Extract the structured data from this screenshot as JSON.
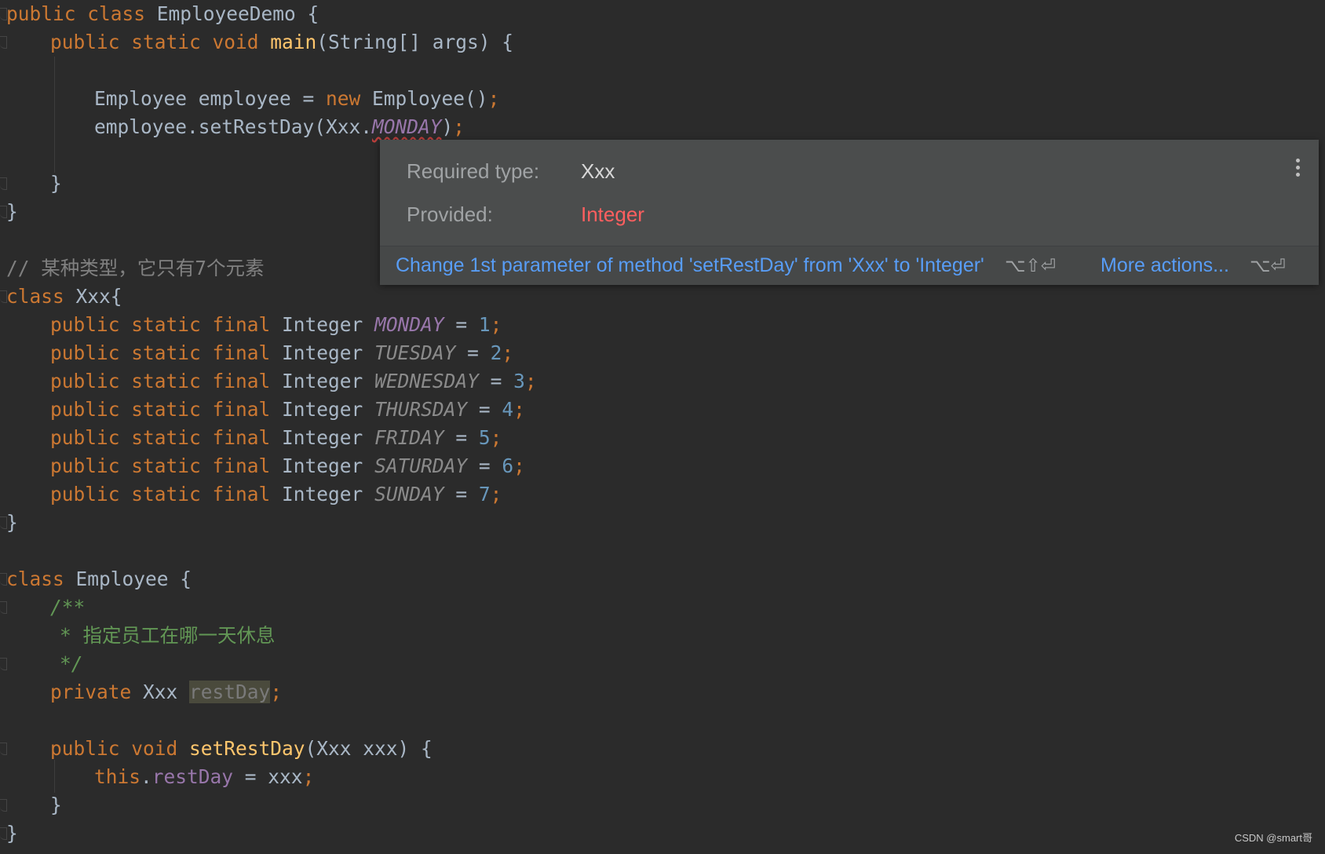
{
  "code": {
    "l1": [
      "public class",
      "EmployeeDemo {"
    ],
    "l2": [
      "public static void",
      "main",
      "(String[] args) {"
    ],
    "l3": [
      "Employee employee = ",
      "new",
      "Employee()",
      ";"
    ],
    "l4": [
      "employee.setRestDay(Xxx.",
      "MONDAY",
      ")",
      ";"
    ],
    "l5": "}",
    "l6": "}",
    "l7": "// 某种类型，它只有7个元素",
    "l8": [
      "class",
      "Xxx{"
    ],
    "consts": [
      {
        "name": "MONDAY",
        "value": "1"
      },
      {
        "name": "TUESDAY",
        "value": "2"
      },
      {
        "name": "WEDNESDAY",
        "value": "3"
      },
      {
        "name": "THURSDAY",
        "value": "4"
      },
      {
        "name": "FRIDAY",
        "value": "5"
      },
      {
        "name": "SATURDAY",
        "value": "6"
      },
      {
        "name": "SUNDAY",
        "value": "7"
      }
    ],
    "const_prefix": "public static final",
    "const_type": "Integer",
    "close_brace": "}",
    "l17": [
      "class",
      "Employee {"
    ],
    "doc1": "/**",
    "doc2": "* 指定员工在哪一天休息",
    "doc3": "*/",
    "l21": [
      "private",
      "Xxx ",
      "restDay",
      ";"
    ],
    "l23": [
      "public void",
      "setRestDay",
      "(Xxx xxx) {"
    ],
    "l24": [
      "this",
      ".",
      "restDay",
      " = xxx",
      ";"
    ],
    "l25": "}",
    "l26": "}"
  },
  "popup": {
    "required_label": "Required type:",
    "required_value": "Xxx",
    "provided_label": "Provided:",
    "provided_value": "Integer",
    "fix_action": "Change 1st parameter of method 'setRestDay' from 'Xxx' to 'Integer'",
    "fix_shortcut": "⌥⇧⏎",
    "more_actions": "More actions...",
    "more_shortcut": "⌥⏎",
    "menu_icon": "vertical-dots-icon",
    "error_color": "#ff5f5f",
    "link_color": "#589df6"
  },
  "watermark": "CSDN @smart哥"
}
